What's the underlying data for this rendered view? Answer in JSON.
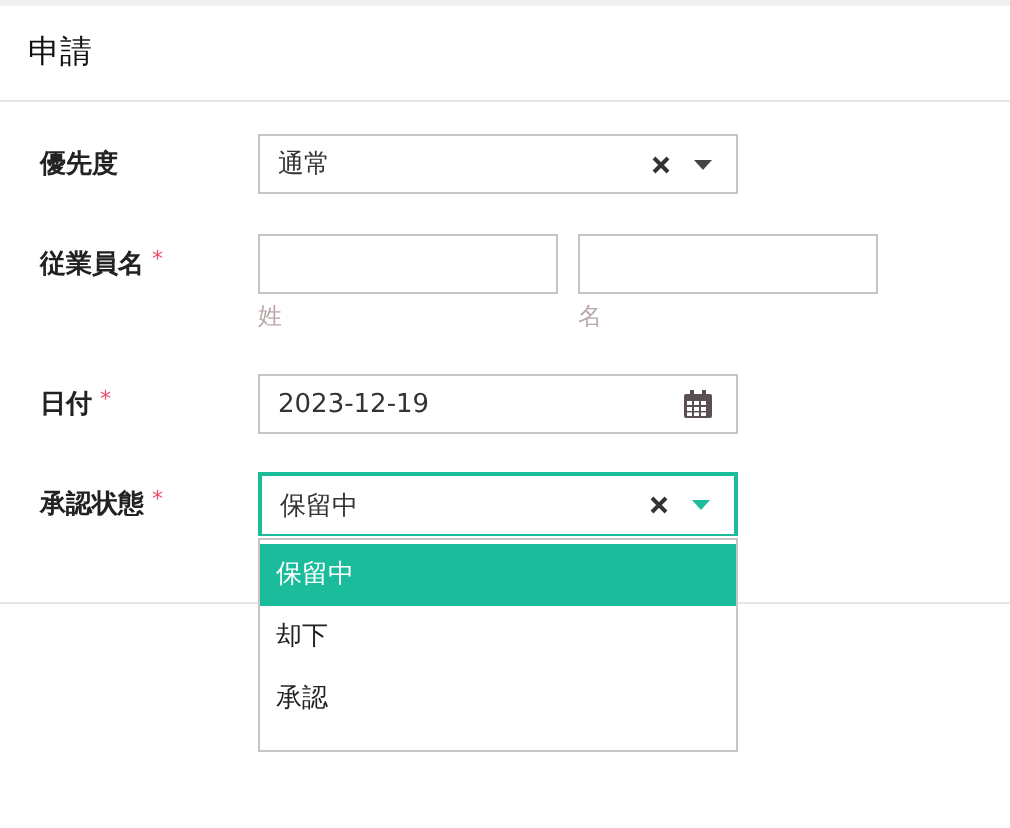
{
  "header": {
    "title": "申請"
  },
  "fields": [
    {
      "kind": "select",
      "label": "優先度",
      "value": "通常",
      "expanded": false
    },
    {
      "kind": "name",
      "label": "従業員名",
      "required_mark": "*",
      "parts": [
        {
          "sublabel": "姓"
        },
        {
          "sublabel": "名"
        }
      ]
    },
    {
      "kind": "date",
      "label": "日付",
      "required_mark": "*",
      "value": "2023-12-19"
    },
    {
      "kind": "select",
      "label": "承認状態",
      "required_mark": "*",
      "value": "保留中",
      "expanded": true,
      "options": [
        {
          "label": "保留中",
          "selected": true
        },
        {
          "label": "却下",
          "selected": false
        },
        {
          "label": "承認",
          "selected": false
        }
      ]
    }
  ]
}
